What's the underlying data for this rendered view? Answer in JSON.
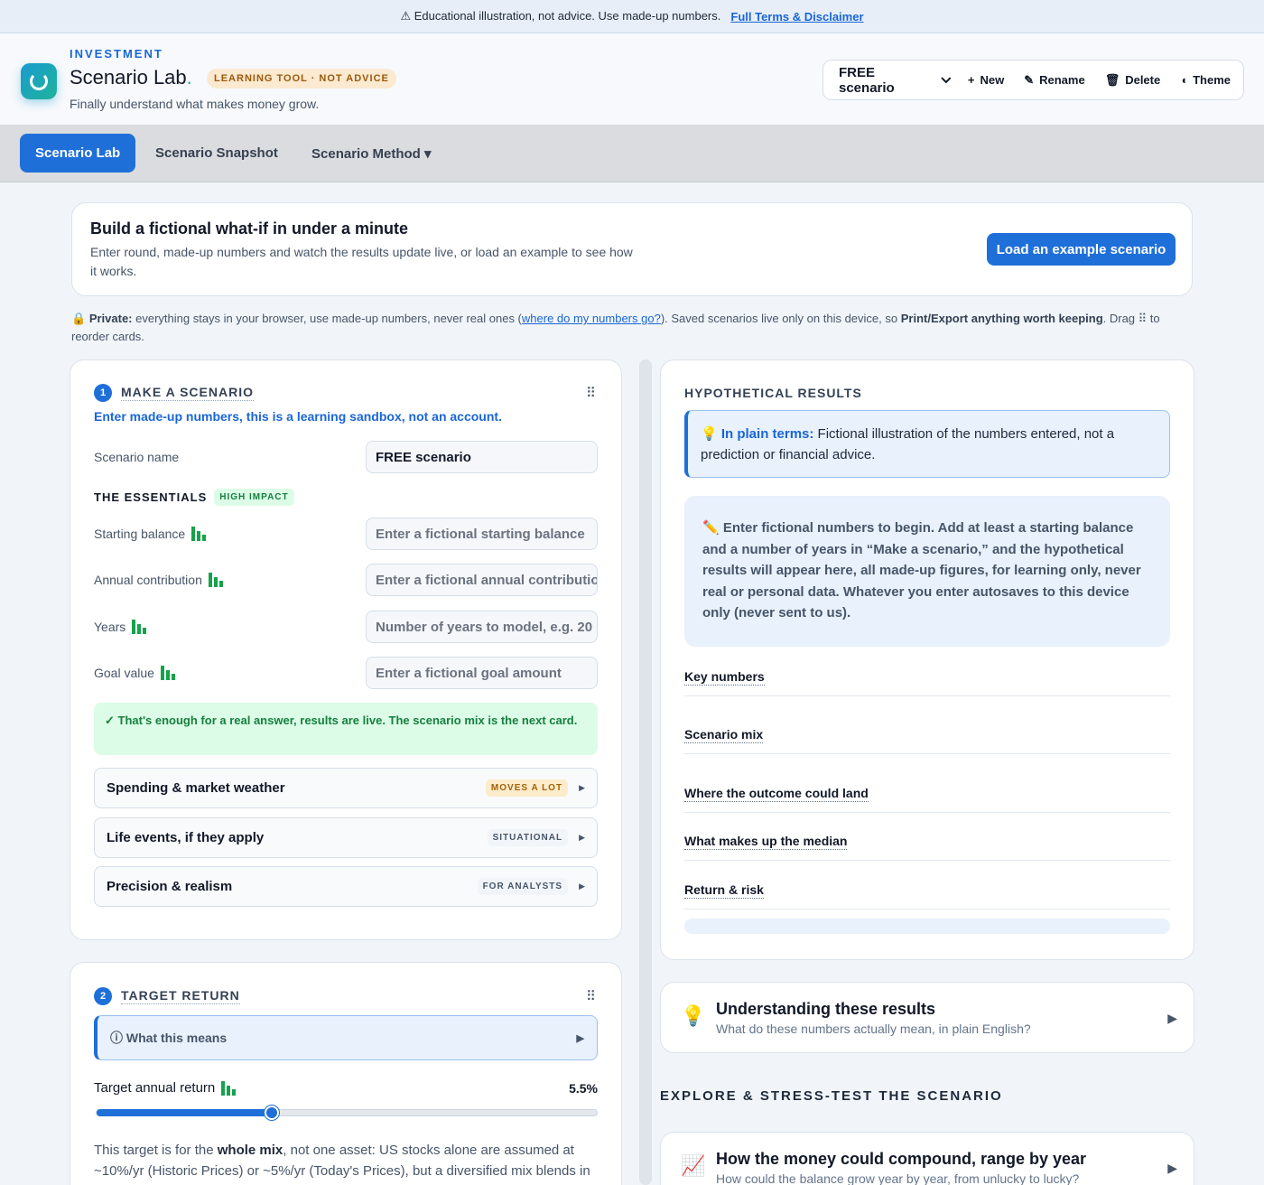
{
  "banner": {
    "text": "⚠ Educational illustration, not advice. Use made-up numbers.",
    "link": "Full Terms & Disclaimer"
  },
  "header": {
    "kicker": "INVESTMENT",
    "title": "Scenario Lab",
    "title_dot": ".",
    "pill": "LEARNING TOOL · NOT ADVICE",
    "tagline": "Finally understand what makes money grow.",
    "logo_icon": "refresh-ring-icon"
  },
  "toolbar": {
    "scenario_select": "FREE scenario",
    "new_label": "New",
    "rename_label": "Rename",
    "delete_label": "Delete",
    "theme_label": "Theme",
    "icons": {
      "new": "+",
      "rename": "✎",
      "delete": "🗑",
      "theme": "◖",
      "chevron": "⌄"
    }
  },
  "nav": {
    "tabs": [
      {
        "label": "Scenario Lab",
        "active": true
      },
      {
        "label": "Scenario Snapshot",
        "active": false
      },
      {
        "label": "Scenario Method ▾",
        "active": false
      }
    ]
  },
  "intro": {
    "title": "Build a fictional what-if in under a minute",
    "description": "Enter round, made-up numbers and watch the results update live, or load an example to see how it works.",
    "button": "Load an example scenario"
  },
  "privacy": {
    "icon": "🔒",
    "label": "Private:",
    "text_before_link": " everything stays in your browser, use made-up numbers, never real ones (",
    "link": "where do my numbers go?",
    "text_after_link": "). Saved scenarios live only on this device, so ",
    "bold_text": "Print/Export anything worth keeping",
    "text_end": ". Drag ⠿ to reorder cards."
  },
  "make_scenario": {
    "number": "1",
    "title": "MAKE A SCENARIO",
    "drag_icon": "⠿",
    "note": "Enter made-up numbers, this is a learning sandbox, not an account.",
    "name_label": "Scenario name",
    "name_value": "FREE scenario",
    "essentials_label": "THE ESSENTIALS",
    "essentials_tag": "HIGH IMPACT",
    "fields": [
      {
        "label": "Starting balance",
        "placeholder": "Enter a fictional starting balance"
      },
      {
        "label": "Annual contribution",
        "placeholder": "Enter a fictional annual contribution"
      },
      {
        "label": "Years",
        "placeholder": "Number of years to model, e.g. 20"
      },
      {
        "label": "Goal value",
        "placeholder": "Enter a fictional goal amount"
      }
    ],
    "success": "✓ That's enough for a real answer, results are live. The scenario mix is the next card.",
    "accordions": [
      {
        "title": "Spending & market weather",
        "tag": "MOVES A LOT",
        "tag_color": "amber"
      },
      {
        "title": "Life events, if they apply",
        "tag": "SITUATIONAL",
        "tag_color": "gray"
      },
      {
        "title": "Precision & realism",
        "tag": "FOR ANALYSTS",
        "tag_color": "gray"
      }
    ]
  },
  "target_return": {
    "number": "2",
    "title": "TARGET RETURN",
    "what_this_means": "ⓘ What this means",
    "slider_label": "Target annual return",
    "slider_value": "5.5%",
    "slider_fraction": 0.35,
    "desc_1": "This target is for the ",
    "desc_bold": "whole mix",
    "desc_2": ", not one asset: US stocks alone are assumed at ~10%/yr (Historic Prices) or ~5%/yr (Today's Prices), but a diversified mix blends in"
  },
  "results": {
    "title": "HYPOTHETICAL RESULTS",
    "plain_icon": "💡",
    "plain_label": "In plain terms:",
    "plain_text": " Fictional illustration of the numbers entered, not a prediction or financial advice.",
    "begin_text": "✏️ Enter fictional numbers to begin. Add at least a starting balance and a number of years in “Make a scenario,” and the hypothetical results will appear here, all made-up figures, for learning only, never real or personal data. Whatever you enter autosaves to this device only (never sent to us).",
    "sections": [
      "Key numbers",
      "Scenario mix",
      "Where the outcome could land",
      "What makes up the median",
      "Return & risk"
    ]
  },
  "understanding": {
    "icon": "💡",
    "title": "Understanding these results",
    "subtitle": "What do these numbers actually mean, in plain English?"
  },
  "explore": {
    "heading": "EXPLORE & STRESS-TEST THE SCENARIO",
    "card_icon": "📈",
    "card_title": "How the money could compound, range by year",
    "card_subtitle": "How could the balance grow year by year, from unlucky to lucky?"
  },
  "colors": {
    "accent": "#1f6fd9",
    "teal": "#1fb39a",
    "success_bg": "#dcfce7",
    "success_text": "#15803d",
    "panel_blue": "#e8f1fc"
  }
}
